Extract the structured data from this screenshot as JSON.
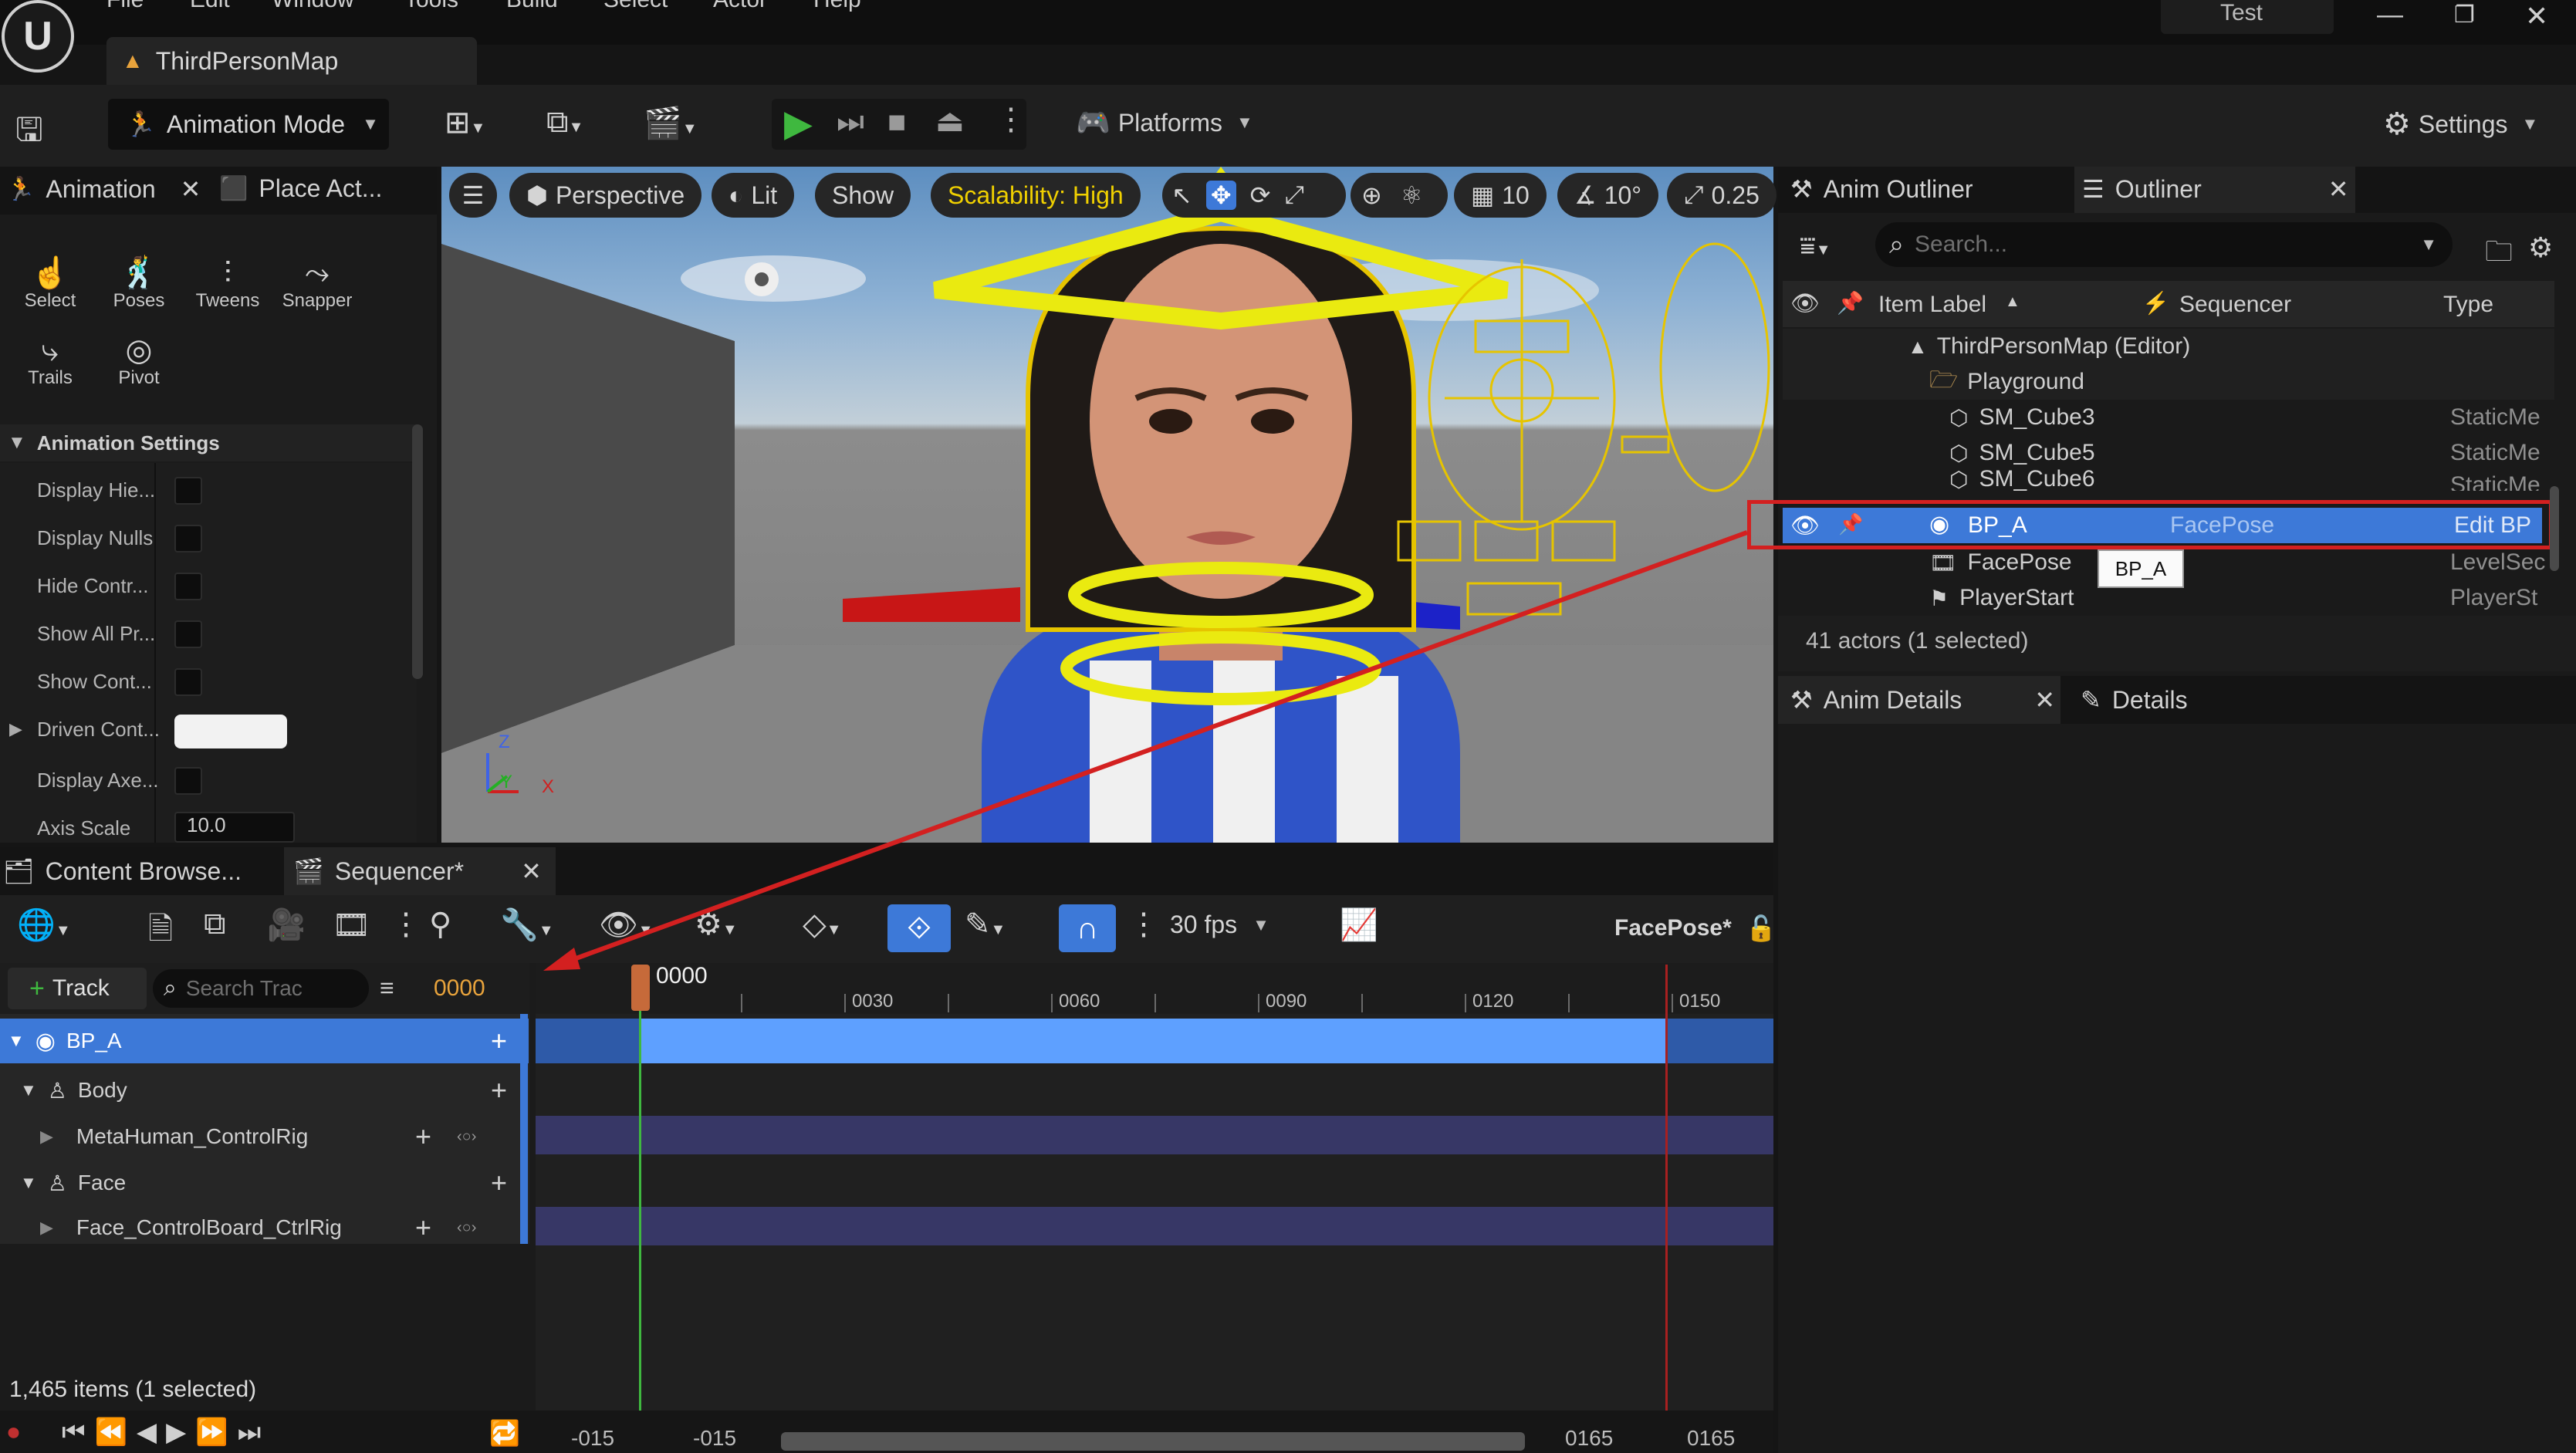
{
  "menu": {
    "items": [
      "File",
      "Edit",
      "Window",
      "Tools",
      "Build",
      "Select",
      "Actor",
      "Help"
    ],
    "project": "Test"
  },
  "level_tab": {
    "label": "ThirdPersonMap"
  },
  "toolbar": {
    "mode": "Animation Mode",
    "platforms": "Platforms",
    "settings": "Settings"
  },
  "left_panel": {
    "tabs": [
      "Animation",
      "Place Act..."
    ],
    "tools": [
      "Select",
      "Poses",
      "Tweens",
      "Snapper",
      "Trails",
      "Pivot"
    ],
    "section": "Animation Settings",
    "settings": [
      "Display Hie...",
      "Display Nulls",
      "Hide Contr...",
      "Show All Pr...",
      "Show Cont...",
      "Driven Cont...",
      "Display Axe...",
      "Axis Scale"
    ],
    "axis_scale_value": "10.0"
  },
  "viewport": {
    "perspective": "Perspective",
    "lit": "Lit",
    "show": "Show",
    "scalability": "Scalability: High",
    "grid": "10",
    "angle": "10°",
    "scale": "0.25",
    "axes": {
      "z": "Z",
      "y": "Y",
      "x": "X"
    }
  },
  "outliner": {
    "tabs": [
      "Anim Outliner",
      "Outliner"
    ],
    "search_placeholder": "Search...",
    "columns": {
      "label": "Item Label",
      "sequencer": "Sequencer",
      "type": "Type"
    },
    "rows": [
      {
        "label": "ThirdPersonMap (Editor)",
        "seq": "",
        "type": ""
      },
      {
        "label": "Playground",
        "seq": "",
        "type": ""
      },
      {
        "label": "SM_Cube3",
        "seq": "",
        "type": "StaticMe"
      },
      {
        "label": "SM_Cube5",
        "seq": "",
        "type": "StaticMe"
      },
      {
        "label": "SM_Cube6",
        "seq": "",
        "type": "StaticMe"
      },
      {
        "label": "BP_A",
        "seq": "FacePose",
        "type": "Edit BP"
      },
      {
        "label": "FacePose",
        "seq": "",
        "type": "LevelSec"
      },
      {
        "label": "PlayerStart",
        "seq": "",
        "type": "PlayerSt"
      }
    ],
    "tooltip": "BP_A",
    "status": "41 actors (1 selected)"
  },
  "details": {
    "tabs": [
      "Anim Details",
      "Details"
    ]
  },
  "sequencer": {
    "tabs": [
      "Content Browse...",
      "Sequencer*"
    ],
    "fps": "30 fps",
    "sequence_name": "FacePose*",
    "track_button": "Track",
    "search_placeholder": "Search Trac",
    "current_frame": "0000",
    "playhead_label": "0000",
    "ticks": [
      "0030",
      "0060",
      "0090",
      "0120",
      "0150"
    ],
    "tracks": [
      {
        "name": "BP_A"
      },
      {
        "name": "Body"
      },
      {
        "name": "MetaHuman_ControlRig"
      },
      {
        "name": "Face"
      },
      {
        "name": "Face_ControlBoard_CtrlRig"
      }
    ],
    "range_start_a": "-015",
    "range_start_b": "-015",
    "range_end_a": "0165",
    "range_end_b": "0165",
    "content_status": "1,465 items (1 selected)"
  },
  "colors": {
    "accent": "#3d79d8",
    "selection": "#4286e4",
    "annotation": "#d32020",
    "scalability": "#f0d000"
  }
}
